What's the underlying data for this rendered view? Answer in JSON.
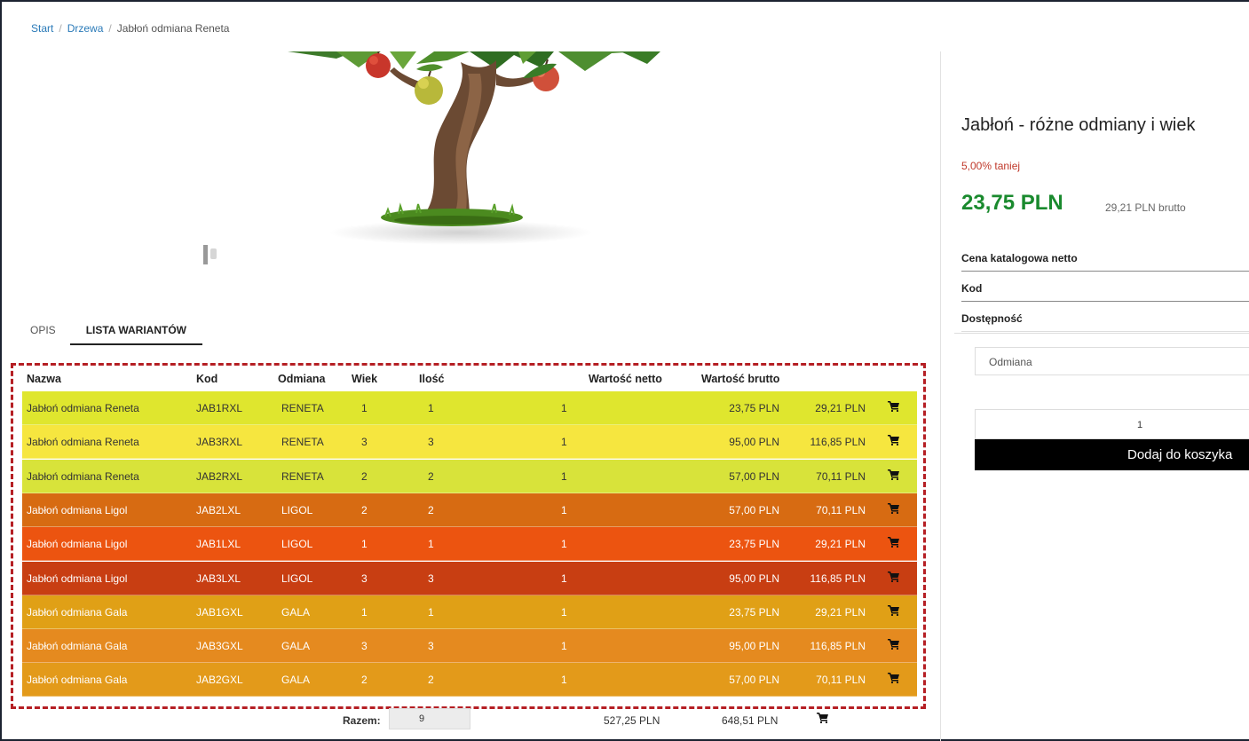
{
  "breadcrumb": {
    "start": "Start",
    "drzewa": "Drzewa",
    "current": "Jabłoń odmiana Reneta"
  },
  "tabs": {
    "opis": "OPIS",
    "lista": "LISTA WARIANTÓW"
  },
  "table": {
    "headers": {
      "nazwa": "Nazwa",
      "kod": "Kod",
      "odmiana": "Odmiana",
      "wiek": "Wiek",
      "ilosc": "Ilość",
      "netto": "Wartość netto",
      "brutto": "Wartość brutto"
    },
    "rows": [
      {
        "name": "Jabłoń odmiana Reneta",
        "kod": "JAB1RXL",
        "odmiana": "RENETA",
        "wiek": "1",
        "ilosc": "1",
        "qty": "1",
        "netto": "23,75 PLN",
        "brutto": "29,21 PLN",
        "bg": "#dfe62e",
        "fg": "#333333"
      },
      {
        "name": "Jabłoń odmiana Reneta",
        "kod": "JAB3RXL",
        "odmiana": "RENETA",
        "wiek": "3",
        "ilosc": "3",
        "qty": "1",
        "netto": "95,00 PLN",
        "brutto": "116,85 PLN",
        "bg": "#f6e63f",
        "fg": "#333333"
      },
      {
        "name": "Jabłoń odmiana Reneta",
        "kod": "JAB2RXL",
        "odmiana": "RENETA",
        "wiek": "2",
        "ilosc": "2",
        "qty": "1",
        "netto": "57,00 PLN",
        "brutto": "70,11 PLN",
        "bg": "#d8e33a",
        "fg": "#333333"
      },
      {
        "name": "Jabłoń odmiana Ligol",
        "kod": "JAB2LXL",
        "odmiana": "LIGOL",
        "wiek": "2",
        "ilosc": "2",
        "qty": "1",
        "netto": "57,00 PLN",
        "brutto": "70,11 PLN",
        "bg": "#d76b12",
        "fg": "#ffffff"
      },
      {
        "name": "Jabłoń odmiana Ligol",
        "kod": "JAB1LXL",
        "odmiana": "LIGOL",
        "wiek": "1",
        "ilosc": "1",
        "qty": "1",
        "netto": "23,75 PLN",
        "brutto": "29,21 PLN",
        "bg": "#ec5410",
        "fg": "#ffffff"
      },
      {
        "name": "Jabłoń odmiana Ligol",
        "kod": "JAB3LXL",
        "odmiana": "LIGOL",
        "wiek": "3",
        "ilosc": "3",
        "qty": "1",
        "netto": "95,00 PLN",
        "brutto": "116,85 PLN",
        "bg": "#c83e12",
        "fg": "#ffffff"
      },
      {
        "name": "Jabłoń odmiana Gala",
        "kod": "JAB1GXL",
        "odmiana": "GALA",
        "wiek": "1",
        "ilosc": "1",
        "qty": "1",
        "netto": "23,75 PLN",
        "brutto": "29,21 PLN",
        "bg": "#e0a016",
        "fg": "#ffffff"
      },
      {
        "name": "Jabłoń odmiana Gala",
        "kod": "JAB3GXL",
        "odmiana": "GALA",
        "wiek": "3",
        "ilosc": "3",
        "qty": "1",
        "netto": "95,00 PLN",
        "brutto": "116,85 PLN",
        "bg": "#e58a1f",
        "fg": "#ffffff"
      },
      {
        "name": "Jabłoń odmiana Gala",
        "kod": "JAB2GXL",
        "odmiana": "GALA",
        "wiek": "2",
        "ilosc": "2",
        "qty": "1",
        "netto": "57,00 PLN",
        "brutto": "70,11 PLN",
        "bg": "#e39a1a",
        "fg": "#ffffff"
      }
    ],
    "razem": {
      "label": "Razem:",
      "qty": "9",
      "netto": "527,25 PLN",
      "brutto": "648,51 PLN"
    }
  },
  "product": {
    "title": "Jabłoń - różne odmiany i wiek",
    "discount": "5,00% taniej",
    "price_net": "23,75 PLN",
    "price_brutto": "29,21 PLN brutto",
    "specs": {
      "cena": "Cena katalogowa netto",
      "kod": "Kod",
      "dostepnosc": "Dostępność"
    },
    "odmiana_select": "Odmiana",
    "quantity": "1",
    "add_to_cart": "Dodaj do koszyka"
  },
  "icons": {
    "cart": "cart-icon"
  }
}
